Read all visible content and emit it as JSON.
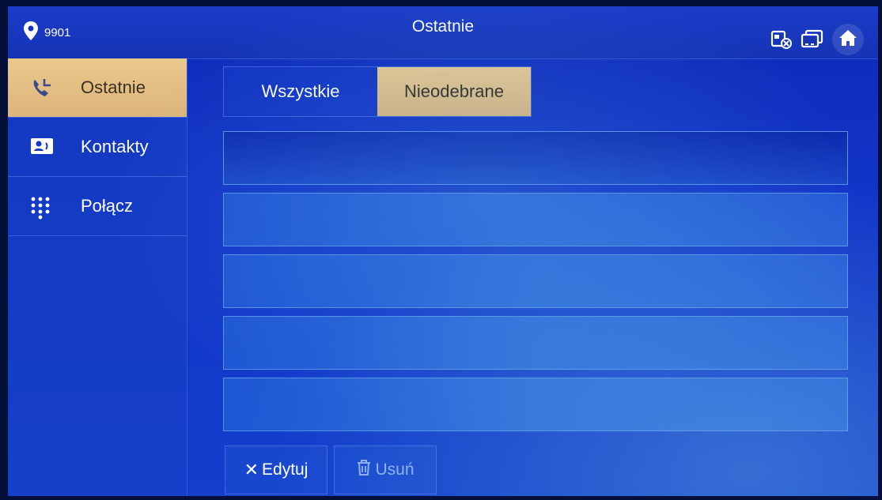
{
  "header": {
    "room_number": "9901",
    "title": "Ostatnie"
  },
  "sidebar": {
    "items": [
      {
        "label": "Ostatnie",
        "icon": "recent-calls-icon",
        "active": true
      },
      {
        "label": "Kontakty",
        "icon": "contact-card-icon",
        "active": false
      },
      {
        "label": "Połącz",
        "icon": "dialpad-icon",
        "active": false
      }
    ]
  },
  "tabs": [
    {
      "label": "Wszystkie",
      "active": false
    },
    {
      "label": "Nieodebrane",
      "active": true
    }
  ],
  "list": {
    "rows": [
      "",
      "",
      "",
      "",
      ""
    ]
  },
  "actions": {
    "edit_label": "Edytuj",
    "delete_label": "Usuń"
  },
  "colors": {
    "accent": "#e2bc84",
    "background": "#1338c2",
    "text": "#ffffff"
  }
}
